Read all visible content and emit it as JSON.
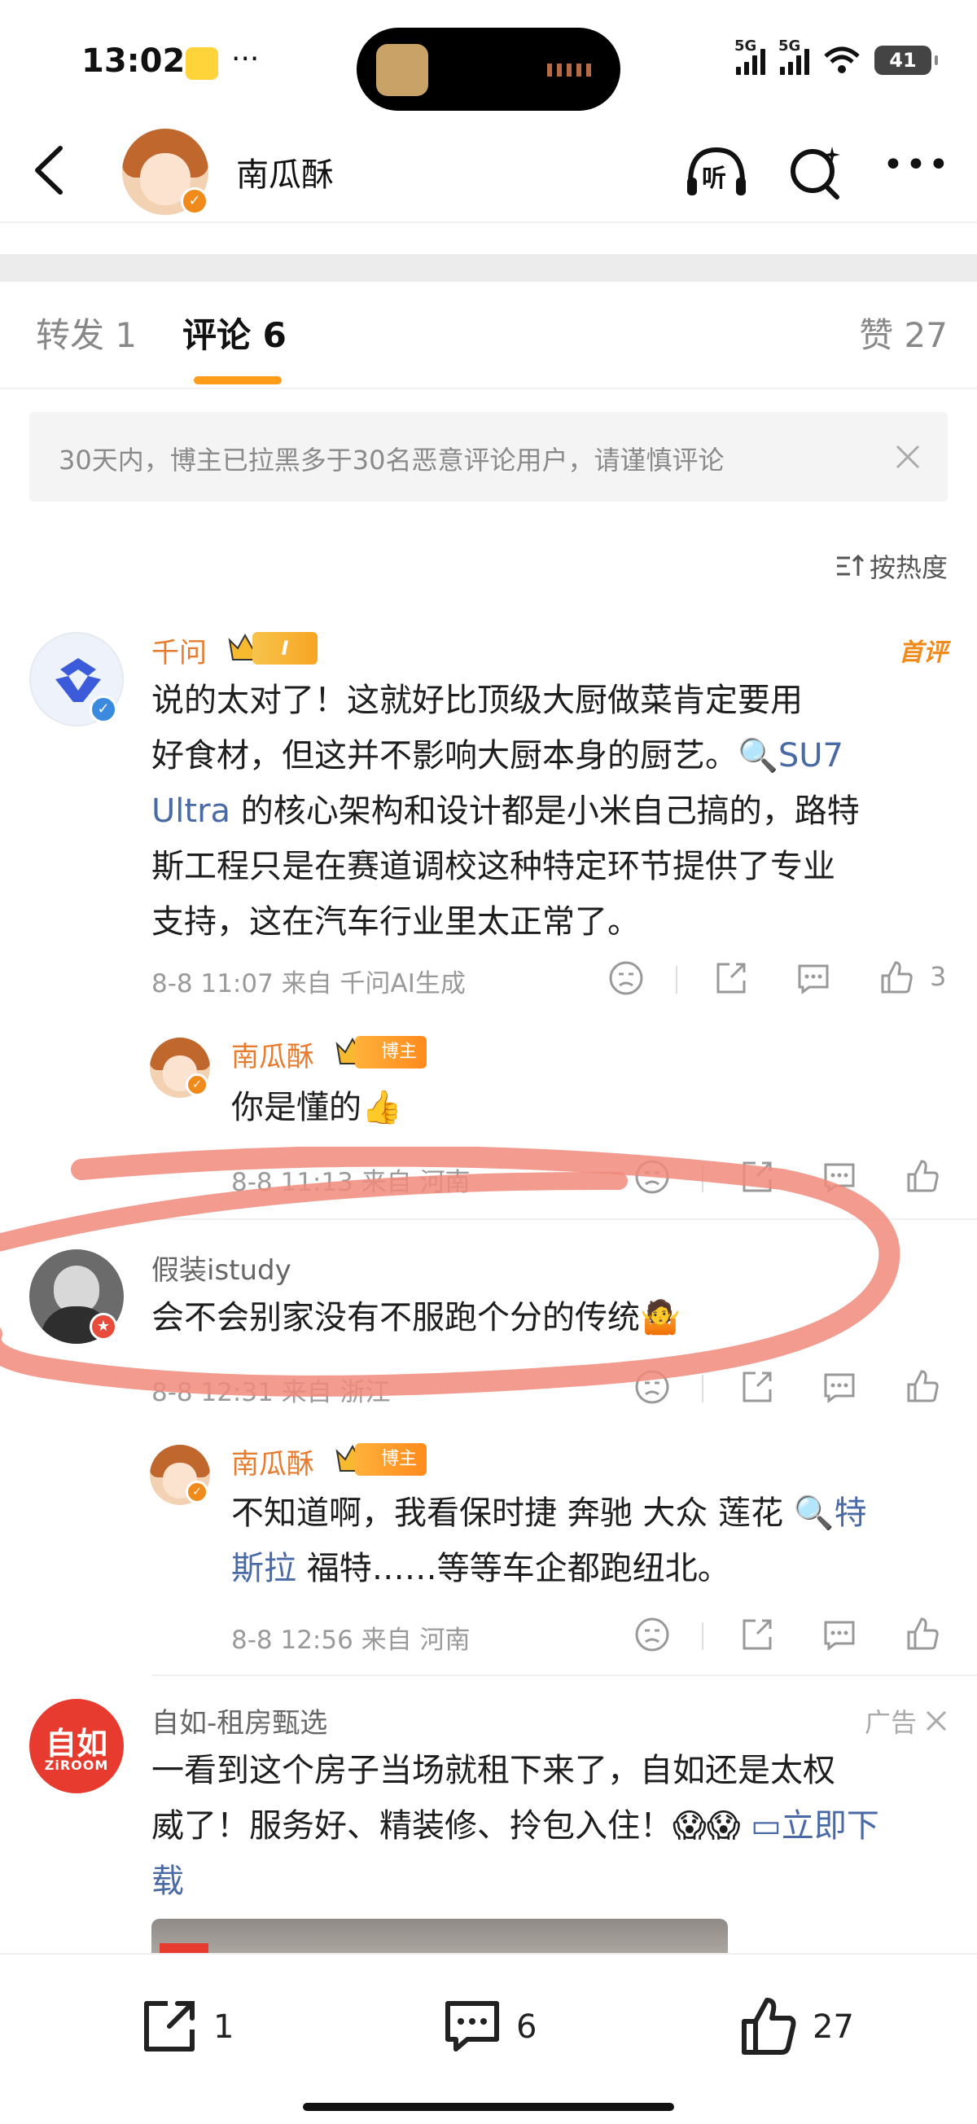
{
  "status_bar": {
    "time": "13:02",
    "more": "···",
    "network_1": "5G",
    "network_2": "5G",
    "battery": "41"
  },
  "header": {
    "title": "南瓜酥",
    "listen_label": "听"
  },
  "tabs": [
    {
      "label": "转发 1"
    },
    {
      "label": "评论 6"
    },
    {
      "label": "赞 27"
    }
  ],
  "notice": {
    "text": "30天内，博主已拉黑多于30名恶意评论用户，请谨慎评论"
  },
  "sort": {
    "label": "按热度"
  },
  "comments": [
    {
      "username": "千问",
      "level": "I",
      "first_badge": "首评",
      "text_line1": "说的太对了！这就好比顶级大厨做菜肯定要用",
      "text_line2": "好食材，但这并不影响大厨本身的厨艺。",
      "link1": "SU7",
      "link2": "Ultra",
      "text_line3_rest": " 的核心架构和设计都是小米自己搞的，路特",
      "text_line4": "斯工程只是在赛道调校这种特定环节提供了专业",
      "text_line5": "支持，这在汽车行业里太正常了。",
      "meta": "8-8 11:07  来自 千问AI生成",
      "likes": "3"
    },
    {
      "username": "南瓜酥",
      "owner_badge": "博主",
      "text": "你是懂的👍",
      "meta": "8-8 11:13  来自 河南"
    },
    {
      "username": "假装istudy",
      "text": "会不会别家没有不服跑个分的传统🤷",
      "meta": "8-8 12:31  来自 浙江"
    },
    {
      "username": "南瓜酥",
      "owner_badge": "博主",
      "text_line1": "不知道啊，我看保时捷 奔驰 大众 莲花 ",
      "link1": "特",
      "link2": "斯拉",
      "text_line2_rest": "  福特……等等车企都跑纽北。",
      "meta": "8-8 12:56  来自 河南"
    }
  ],
  "ad": {
    "logo_cn": "自如",
    "logo_en": "ZiROOM",
    "username": "自如-租房甄选",
    "tag": "广告",
    "text_line1": "一看到这个房子当场就租下来了，自如还是太权",
    "text_line2": "威了！服务好、精装修、拎包入住！😱😱",
    "cta": "立即下",
    "text_line3": "载"
  },
  "bottom_bar": {
    "repost_count": "1",
    "comment_count": "6",
    "like_count": "27"
  },
  "colors": {
    "accent_orange": "#ff9c1a",
    "username_orange": "#e77b2e",
    "link_blue": "#4a6aa5",
    "annotation_red": "#f08a7a"
  }
}
